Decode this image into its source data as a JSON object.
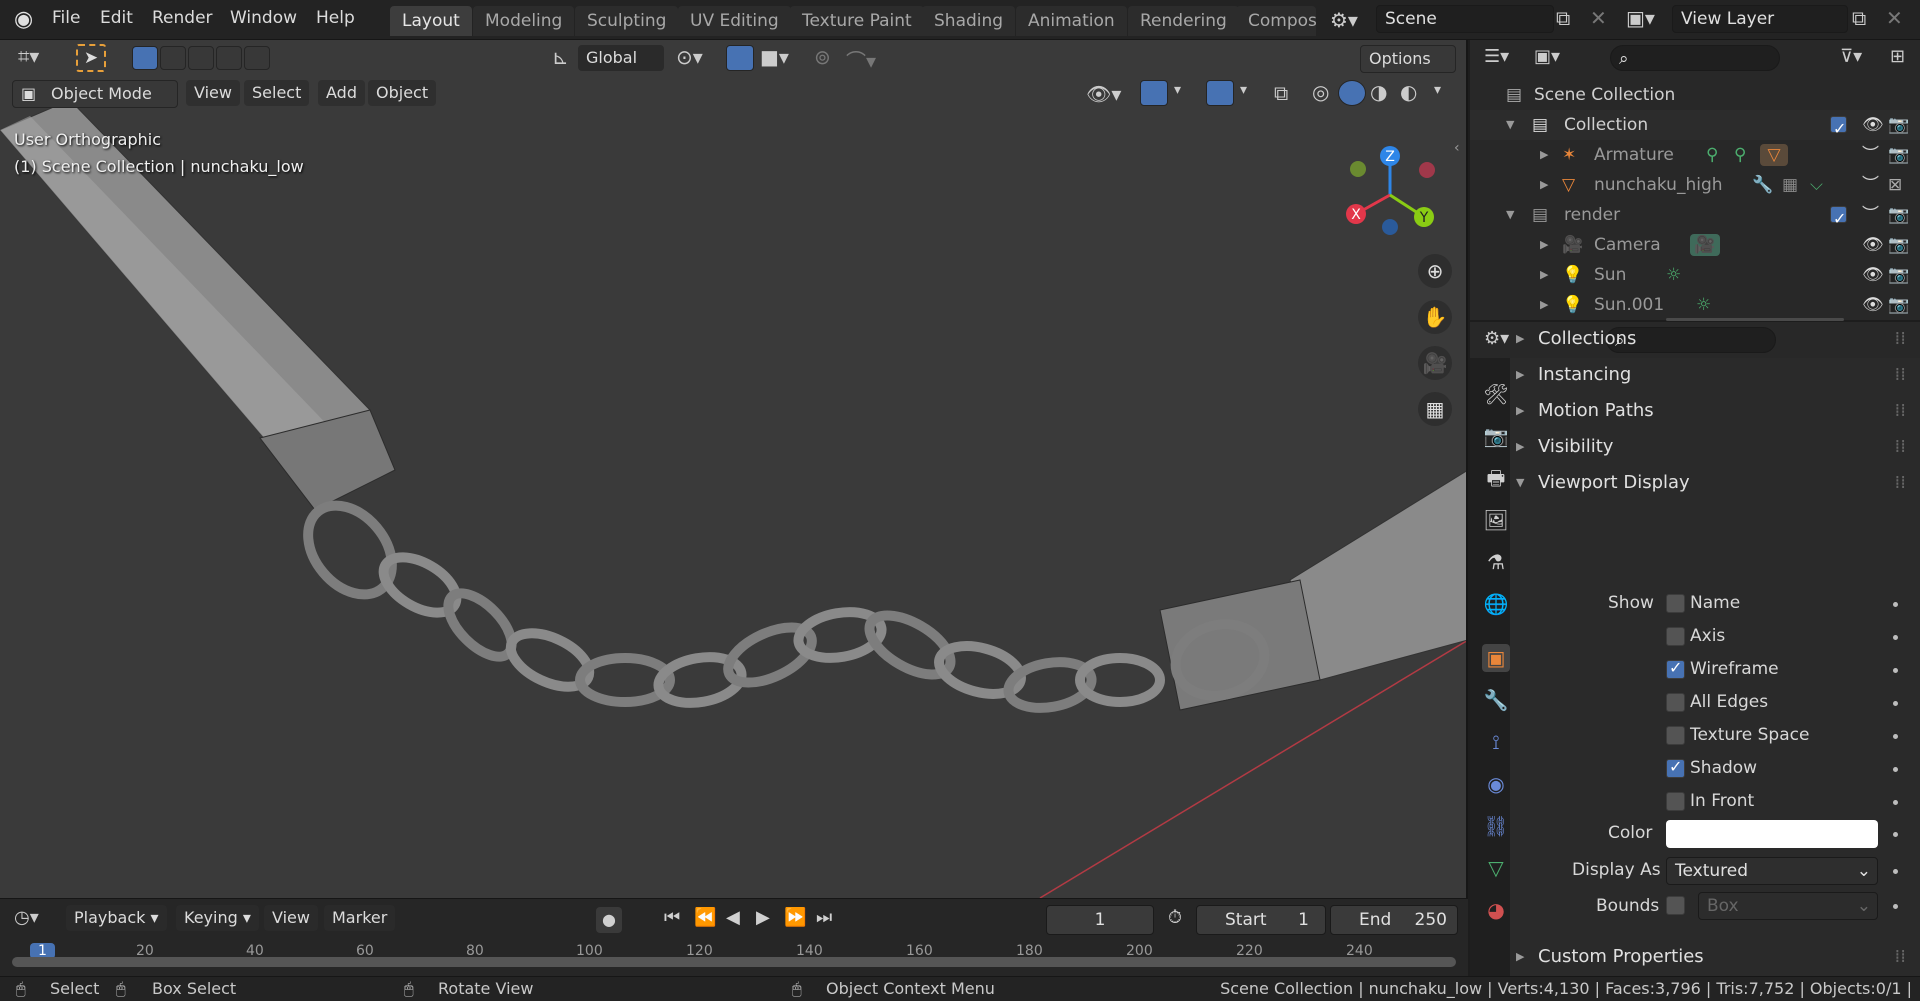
{
  "menu": {
    "file": "File",
    "edit": "Edit",
    "render": "Render",
    "window": "Window",
    "help": "Help"
  },
  "workspaces": [
    "Layout",
    "Modeling",
    "Sculpting",
    "UV Editing",
    "Texture Paint",
    "Shading",
    "Animation",
    "Rendering",
    "Compos"
  ],
  "scene": "Scene",
  "view_layer": "View Layer",
  "toolbar": {
    "transform_orientation": "Global",
    "options": "Options"
  },
  "header": {
    "mode": "Object Mode",
    "view": "View",
    "select": "Select",
    "add": "Add",
    "object": "Object"
  },
  "viewport": {
    "line1": "User Orthographic",
    "line2": "(1) Scene Collection | nunchaku_low"
  },
  "gizmo": {
    "z": "Z",
    "y": "Y",
    "x": "X"
  },
  "outliner": {
    "root": "Scene Collection",
    "collection": "Collection",
    "armature": "Armature",
    "nunchaku_high": "nunchaku_high",
    "render": "render",
    "camera": "Camera",
    "sun": "Sun",
    "sun001": "Sun.001"
  },
  "properties": {
    "panels": {
      "collections": "Collections",
      "instancing": "Instancing",
      "motion_paths": "Motion Paths",
      "visibility": "Visibility",
      "viewport_display": "Viewport Display",
      "custom_properties": "Custom Properties"
    },
    "show_label": "Show",
    "checks": [
      {
        "label": "Name",
        "checked": false
      },
      {
        "label": "Axis",
        "checked": false
      },
      {
        "label": "Wireframe",
        "checked": true
      },
      {
        "label": "All Edges",
        "checked": false
      },
      {
        "label": "Texture Space",
        "checked": false
      },
      {
        "label": "Shadow",
        "checked": true
      },
      {
        "label": "In Front",
        "checked": false
      }
    ],
    "color_label": "Color",
    "color_value": "#ffffff",
    "display_as_label": "Display As",
    "display_as_value": "Textured",
    "bounds_label": "Bounds",
    "bounds_value": "Box"
  },
  "timeline": {
    "playback": "Playback",
    "keying": "Keying",
    "view": "View",
    "marker": "Marker",
    "current_frame": "1",
    "start_label": "Start",
    "start_value": "1",
    "end_label": "End",
    "end_value": "250",
    "ruler": [
      "1",
      "20",
      "40",
      "60",
      "80",
      "100",
      "120",
      "140",
      "160",
      "180",
      "200",
      "220",
      "240"
    ]
  },
  "status": {
    "select": "Select",
    "box_select": "Box Select",
    "rotate_view": "Rotate View",
    "context_menu": "Object Context Menu",
    "info": "Scene Collection | nunchaku_low | Verts:4,130 | Faces:3,796 | Tris:7,752 | Objects:0/1 |"
  },
  "colors": {
    "accent": "#4772b3",
    "x_axis": "#e2374a",
    "y_axis": "#8acc14",
    "z_axis": "#2e86e8",
    "active_orange": "#e8863a"
  }
}
